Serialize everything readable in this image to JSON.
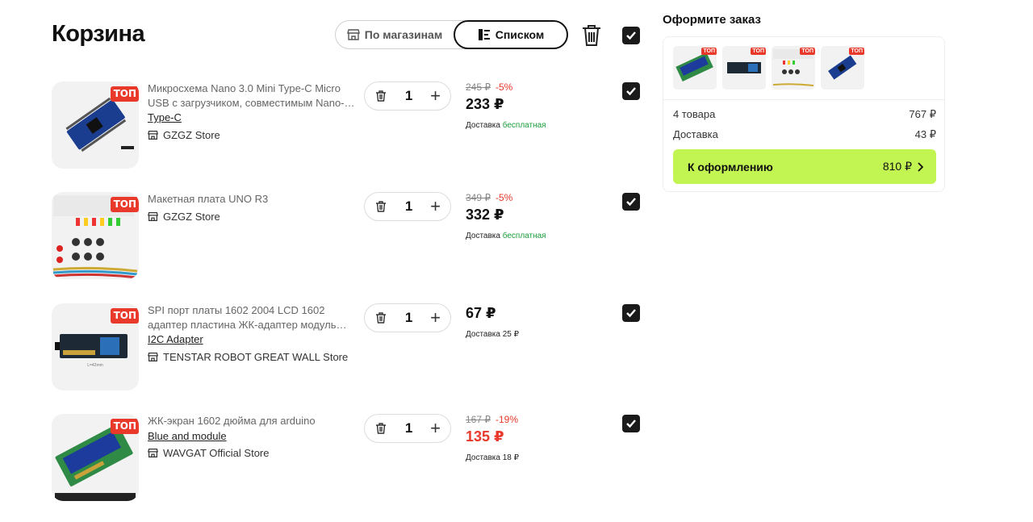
{
  "header": {
    "title": "Корзина",
    "toggle_by_store": "По магазинам",
    "toggle_list": "Списком"
  },
  "items": [
    {
      "name": "Микросхема Nano 3.0 Mini Type-C Micro USB с загрузчиком, совместимым Nano-…",
      "variant": "Type-C",
      "store": "GZGZ Store",
      "badge": "ТОП",
      "quantity": "1",
      "old_price": "245 ₽",
      "discount": "-5%",
      "price": "233 ₽",
      "delivery_label": "Доставка",
      "delivery_value": "бесплатная"
    },
    {
      "name": "Макетная плата UNO R3",
      "variant": "",
      "store": "GZGZ Store",
      "badge": "ТОП",
      "quantity": "1",
      "old_price": "349 ₽",
      "discount": "-5%",
      "price": "332 ₽",
      "delivery_label": "Доставка",
      "delivery_value": "бесплатная"
    },
    {
      "name": "SPI порт платы 1602 2004 LCD 1602 адаптер пластина ЖК-адаптер модуль…",
      "variant": "I2C Adapter",
      "store": "TENSTAR ROBOT GREAT WALL Store",
      "badge": "ТОП",
      "quantity": "1",
      "old_price": "",
      "discount": "",
      "price": "67 ₽",
      "delivery_label": "Доставка 25 ₽",
      "delivery_value": ""
    },
    {
      "name": "ЖК-экран 1602 дюйма для arduino",
      "variant": "Blue and module",
      "store": "WAVGAT Official Store",
      "badge": "ТОП",
      "quantity": "1",
      "old_price": "167 ₽",
      "discount": "-19%",
      "price": "135 ₽",
      "delivery_label": "Доставка 18 ₽",
      "delivery_value": ""
    }
  ],
  "summary": {
    "title": "Оформите заказ",
    "badge": "ТОП",
    "goods_label": "4 товара",
    "goods_value": "767 ₽",
    "delivery_label": "Доставка",
    "delivery_value": "43 ₽",
    "checkout_label": "К оформлению",
    "checkout_value": "810 ₽"
  },
  "colors": {
    "accent_green": "#c2f552",
    "discount_red": "#e8392b",
    "free_green": "#1a9e3a",
    "checkbox": "#1a1a1a"
  },
  "icons": [
    "store-icon",
    "list-icon",
    "trash-icon",
    "checkbox-icon",
    "plus-icon",
    "chevron-right-icon"
  ]
}
